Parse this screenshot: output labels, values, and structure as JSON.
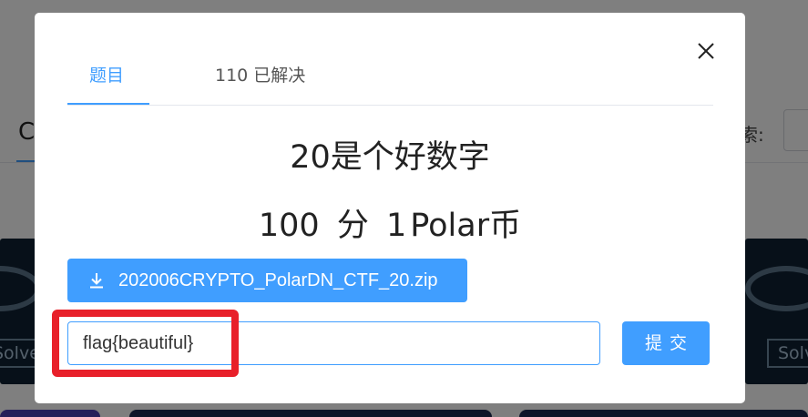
{
  "background": {
    "header_letter": "C",
    "search_label": "索:",
    "card_badge": "Solved"
  },
  "modal": {
    "tabs": [
      {
        "label": "题目",
        "active": true
      },
      {
        "label": "110 已解决",
        "active": false
      }
    ],
    "challenge": {
      "title": "20是个好数字",
      "points": "100",
      "points_unit": "分",
      "coins": "1",
      "coins_unit": "Polar币"
    },
    "download": {
      "icon": "download-icon",
      "filename": "202006CRYPTO_PolarDN_CTF_20.zip"
    },
    "flag_input": {
      "value": "flag{beautiful}",
      "placeholder": ""
    },
    "submit_label": "提交"
  },
  "colors": {
    "primary": "#409eff",
    "annotation": "#e8202a"
  }
}
